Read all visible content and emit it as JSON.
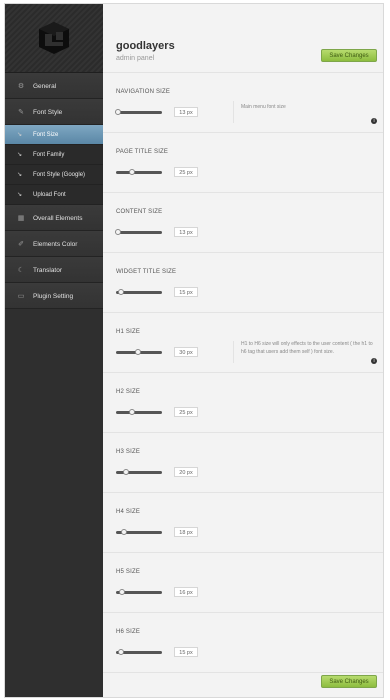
{
  "brand": {
    "name": "goodlayers",
    "subtitle": "admin panel"
  },
  "save_label": "Save Changes",
  "nav": {
    "general": "General",
    "font_style": "Font Style",
    "sub": [
      "Font Size",
      "Font Family",
      "Font Style (Google)",
      "Upload Font"
    ],
    "overall": "Overall Elements",
    "colors": "Elements Color",
    "translator": "Translator",
    "plugin": "Plugin Setting"
  },
  "sections": [
    {
      "title": "NAVIGATION SIZE",
      "value": "13 px",
      "level": 0.05,
      "desc": "Main menu font size"
    },
    {
      "title": "PAGE TITLE SIZE",
      "value": "25 px",
      "level": 0.35
    },
    {
      "title": "CONTENT SIZE",
      "value": "13 px",
      "level": 0.05
    },
    {
      "title": "WIDGET TITLE SIZE",
      "value": "15 px",
      "level": 0.1
    },
    {
      "title": "H1 SIZE",
      "value": "30 px",
      "level": 0.47,
      "desc": "H1 to H6 size will only effects to the user content ( the h1 to h6 tag that users add them self ) font size."
    },
    {
      "title": "H2 SIZE",
      "value": "25 px",
      "level": 0.35
    },
    {
      "title": "H3 SIZE",
      "value": "20 px",
      "level": 0.22
    },
    {
      "title": "H4 SIZE",
      "value": "18 px",
      "level": 0.17
    },
    {
      "title": "H5 SIZE",
      "value": "16 px",
      "level": 0.12
    },
    {
      "title": "H6 SIZE",
      "value": "15 px",
      "level": 0.1
    }
  ]
}
